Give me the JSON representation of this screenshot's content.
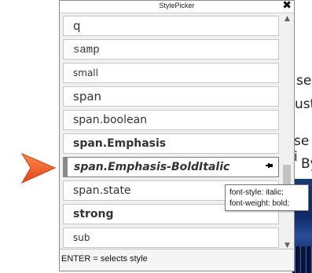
{
  "window": {
    "title": "StylePicker",
    "close_glyph": "✖"
  },
  "items": [
    {
      "label": "q",
      "weight": "normal",
      "style": "normal",
      "size": "15px",
      "family": "\"DejaVu Sans\", sans-serif"
    },
    {
      "label": "samp",
      "weight": "normal",
      "style": "normal",
      "size": "14px",
      "family": "\"Liberation Mono\", monospace"
    },
    {
      "label": "small",
      "weight": "normal",
      "style": "normal",
      "size": "12px",
      "family": "\"DejaVu Sans\", sans-serif"
    },
    {
      "label": "span",
      "weight": "normal",
      "style": "normal",
      "size": "15px",
      "family": "\"DejaVu Sans\", sans-serif"
    },
    {
      "label": "span.boolean",
      "weight": "normal",
      "style": "normal",
      "size": "14px",
      "family": "\"DejaVu Sans\", sans-serif"
    },
    {
      "label": "span.Emphasis",
      "weight": "bold",
      "style": "normal",
      "size": "14px",
      "family": "\"DejaVu Sans\", sans-serif"
    },
    {
      "label": "span.Emphasis-BoldItalic",
      "weight": "bold",
      "style": "italic",
      "size": "14px",
      "family": "\"DejaVu Sans\", sans-serif",
      "selected": true
    },
    {
      "label": "span.state",
      "weight": "normal",
      "style": "normal",
      "size": "14px",
      "family": "\"DejaVu Sans\", sans-serif"
    },
    {
      "label": "strong",
      "weight": "bold",
      "style": "normal",
      "size": "14px",
      "family": "\"DejaVu Sans\", sans-serif"
    },
    {
      "label": "sub",
      "weight": "normal",
      "style": "normal",
      "size": "12px",
      "family": "\"DejaVu Sans\", sans-serif"
    }
  ],
  "tooltip": {
    "line1": "font-style: italic;",
    "line2": "font-weight: bold;"
  },
  "status_text": "ENTER = selects style",
  "background_text": [
    "se",
    "ust",
    "se i",
    "By"
  ],
  "icons": {
    "pin": "pin-icon",
    "scroll_up": "scroll-up-icon",
    "scroll_down": "scroll-down-icon",
    "callout": "callout-arrow"
  },
  "colors": {
    "callout": "#f05a28",
    "selected_marker": "#8a8a8a"
  }
}
